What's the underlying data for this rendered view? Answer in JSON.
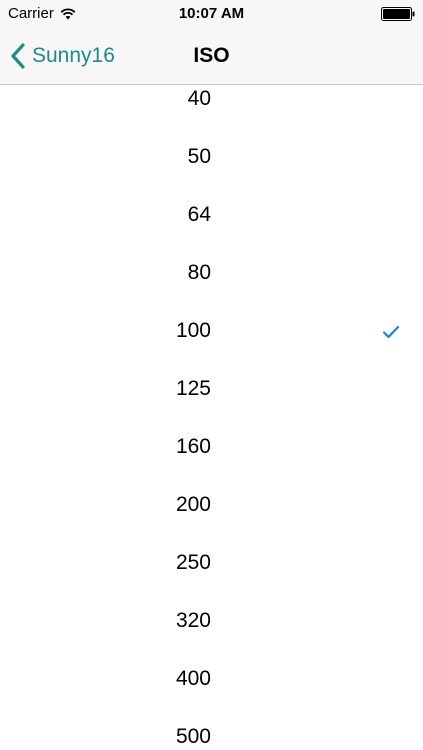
{
  "status_bar": {
    "carrier": "Carrier",
    "time": "10:07 AM",
    "wifi_icon": "wifi-icon",
    "battery_icon": "battery-full-icon"
  },
  "nav": {
    "back_label": "Sunny16",
    "back_icon": "chevron-left-icon",
    "title": "ISO",
    "accent_color": "#1f8a8a"
  },
  "iso_list": {
    "selected": "100",
    "check_icon": "checkmark-icon",
    "check_color": "#1a82e2",
    "items": [
      "40",
      "50",
      "64",
      "80",
      "100",
      "125",
      "160",
      "200",
      "250",
      "320",
      "400",
      "500"
    ]
  }
}
